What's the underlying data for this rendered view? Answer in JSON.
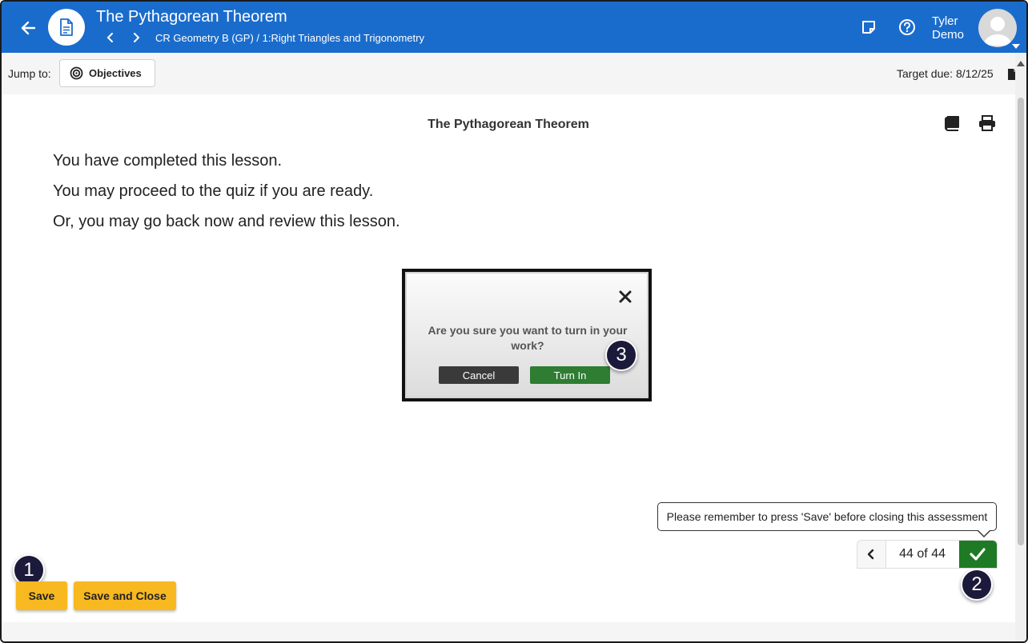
{
  "header": {
    "title": "The Pythagorean Theorem",
    "breadcrumb": "CR Geometry B (GP) / 1:Right Triangles and Trigonometry",
    "user_first": "Tyler",
    "user_last": "Demo",
    "icons": [
      "back-arrow-icon",
      "document-icon",
      "chevron-left-icon",
      "chevron-right-icon",
      "notes-icon",
      "help-icon",
      "avatar",
      "caret-down-icon"
    ]
  },
  "jumpbar": {
    "label": "Jump to:",
    "objectives_label": "Objectives",
    "target_due": "Target due: 8/12/25"
  },
  "content": {
    "title": "The Pythagorean Theorem",
    "lines": [
      "You have completed this lesson.",
      "You may proceed to the quiz if you are ready.",
      "Or, you may go back now and review this lesson."
    ]
  },
  "modal": {
    "question": "Are you sure you want to turn in your work?",
    "cancel_label": "Cancel",
    "turnin_label": "Turn In"
  },
  "badges": [
    "1",
    "2",
    "3"
  ],
  "tooltip": "Please remember to press 'Save' before closing this assessment",
  "pager": {
    "count": "44 of 44"
  },
  "footer": {
    "save_label": "Save",
    "save_close_label": "Save and Close"
  },
  "colors": {
    "header_bg": "#1a6ccc",
    "save_bg": "#f8b820",
    "submit_bg": "#1e7a25",
    "turnin_bg": "#2e7d32",
    "badge_bg": "#1c1a3a"
  }
}
